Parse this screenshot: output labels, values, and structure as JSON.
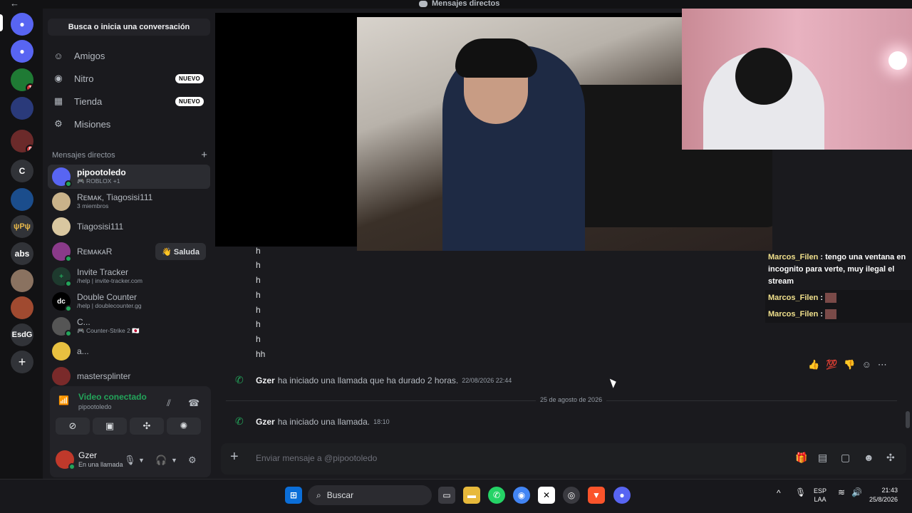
{
  "window": {
    "title": "Mensajes directos",
    "back": "←"
  },
  "colors": {
    "accent": "#5865f2",
    "online": "#23a55a",
    "danger": "#da373c"
  },
  "servers": [
    {
      "label": "",
      "badge": ""
    },
    {
      "label": "",
      "badge": ""
    },
    {
      "label": "",
      "badge": "1"
    },
    {
      "label": "",
      "badge": ""
    },
    {
      "label": "",
      "badge": "8"
    },
    {
      "label": "C",
      "badge": ""
    },
    {
      "label": "",
      "badge": ""
    },
    {
      "label": "ψPψ",
      "badge": ""
    },
    {
      "label": "abs",
      "badge": ""
    },
    {
      "label": "",
      "badge": ""
    },
    {
      "label": "",
      "badge": ""
    },
    {
      "label": "EsdG",
      "badge": ""
    }
  ],
  "sidebar": {
    "search": "Busca o inicia una conversación",
    "nav": [
      {
        "label": "Amigos",
        "tag": ""
      },
      {
        "label": "Nitro",
        "tag": "NUEVO"
      },
      {
        "label": "Tienda",
        "tag": "NUEVO"
      },
      {
        "label": "Misiones",
        "tag": ""
      }
    ],
    "dm_header": "Mensajes directos",
    "dm_add": "+",
    "dms": [
      {
        "name": "pipootoledo",
        "sub": "🎮 ROBLOX +1"
      },
      {
        "name": "Rᴇᴍᴀᴋ, Tiagosisi111",
        "sub": "3 miembros"
      },
      {
        "name": "Tiagosisi111",
        "sub": ""
      },
      {
        "name": "RᴇᴍᴀᴋᴀR",
        "sub": "",
        "action": "👋 Saluda"
      },
      {
        "name": "Invite Tracker",
        "sub": "/help | invite-tracker.com"
      },
      {
        "name": "Double Counter",
        "sub": "/help | doublecounter.gg"
      },
      {
        "name": "C...",
        "sub": "🎮 Counter-Strike 2 🇯🇵"
      },
      {
        "name": "a...",
        "sub": ""
      },
      {
        "name": "mastersplinter",
        "sub": ""
      }
    ]
  },
  "voice": {
    "status": "Video conectado",
    "channel": "pipootoledo"
  },
  "user": {
    "name": "Gzer",
    "status": "En una llamada"
  },
  "chat_overlay": [
    {
      "name": "Marcos_Filen",
      "text": " : tengo una ventana en incognito para verte, muy ilegal el stream"
    },
    {
      "name": "Marcos_Filen",
      "text": " :"
    },
    {
      "name": "Marcos_Filen",
      "text": " :"
    }
  ],
  "messages": {
    "lines": [
      "h",
      "h",
      "h",
      "h",
      "h",
      "h",
      "h",
      "hh"
    ],
    "call1": {
      "user": "Gzer",
      "text": "ha iniciado una llamada que ha durado 2 horas.",
      "time": "22/08/2026 22:44"
    },
    "date_divider": "25 de agosto de 2026",
    "call2": {
      "user": "Gzer",
      "text": "ha iniciado una llamada.",
      "time": "18:10"
    }
  },
  "composer": {
    "placeholder": "Enviar mensaje a @pipootoledo"
  },
  "taskbar": {
    "search": "Buscar",
    "lang_top": "ESP",
    "lang_bottom": "LAA",
    "time": "21:43",
    "date": "25/8/2026"
  }
}
